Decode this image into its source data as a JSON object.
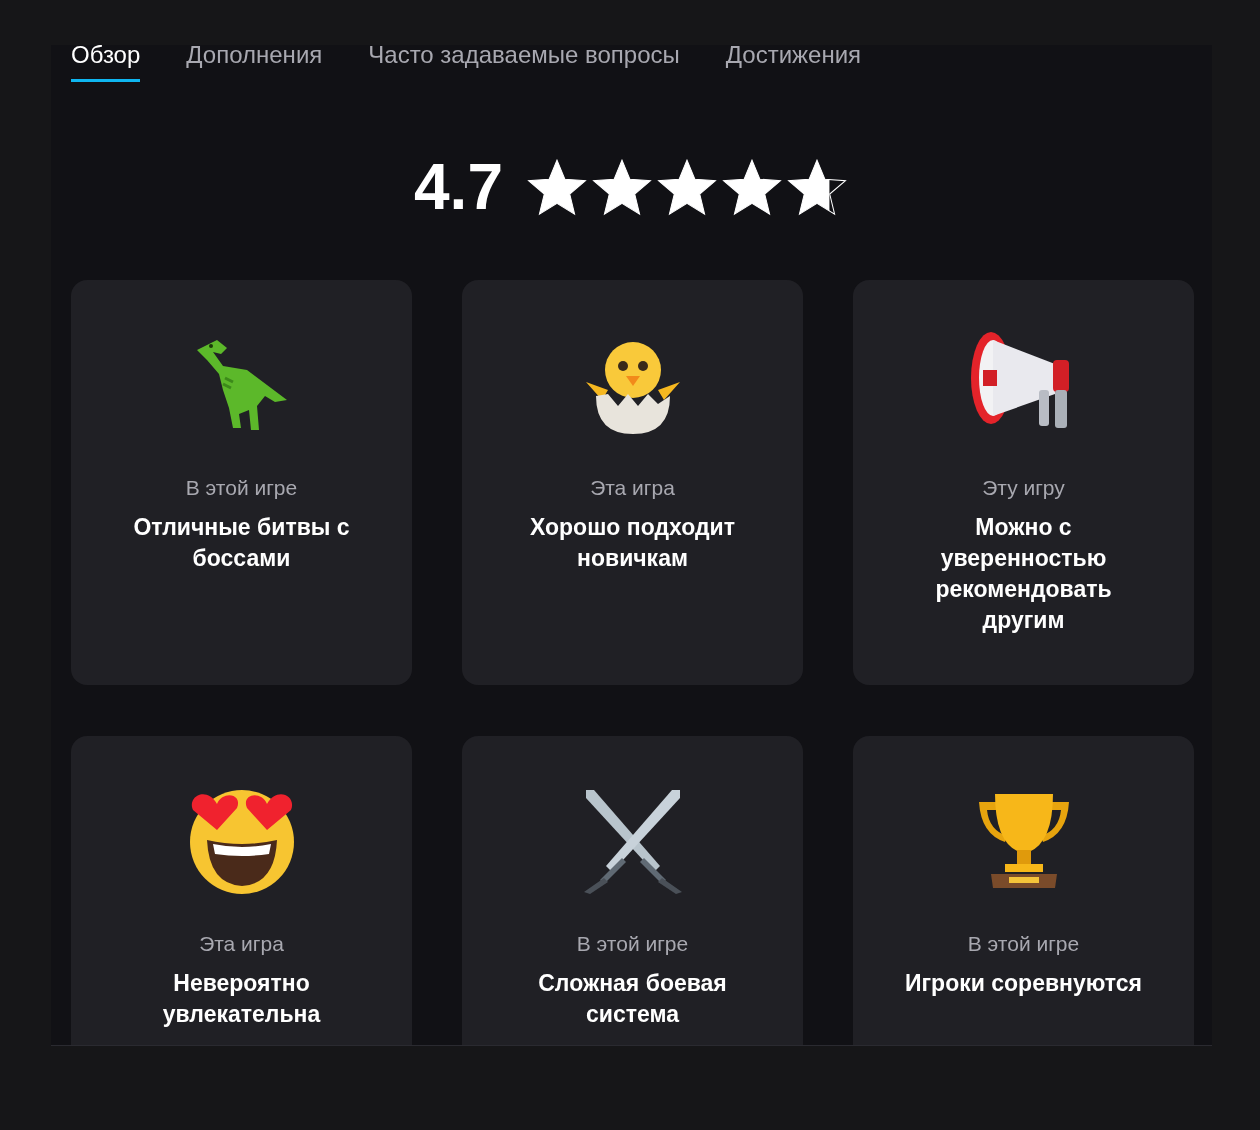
{
  "tabs": [
    {
      "label": "Обзор",
      "selected": true
    },
    {
      "label": "Дополнения",
      "selected": false
    },
    {
      "label": "Часто задаваемые вопросы",
      "selected": false
    },
    {
      "label": "Достижения",
      "selected": false
    }
  ],
  "rating": {
    "score": "4.7",
    "stars": 4.7
  },
  "cards": [
    {
      "kind": "dinosaur",
      "label": "В этой игре",
      "title": "Отличные битвы с боссами"
    },
    {
      "kind": "chick",
      "label": "Эта игра",
      "title": "Хорошо подходит новичкам"
    },
    {
      "kind": "megaphone",
      "label": "Эту игру",
      "title": "Можно с уверенностью рекомендовать другим"
    },
    {
      "kind": "heart-eyes",
      "label": "Эта игра",
      "title": "Невероятно увлекательна"
    },
    {
      "kind": "swords",
      "label": "В этой игре",
      "title": "Сложная боевая система"
    },
    {
      "kind": "trophy",
      "label": "В этой игре",
      "title": "Игроки соревнуются"
    }
  ]
}
